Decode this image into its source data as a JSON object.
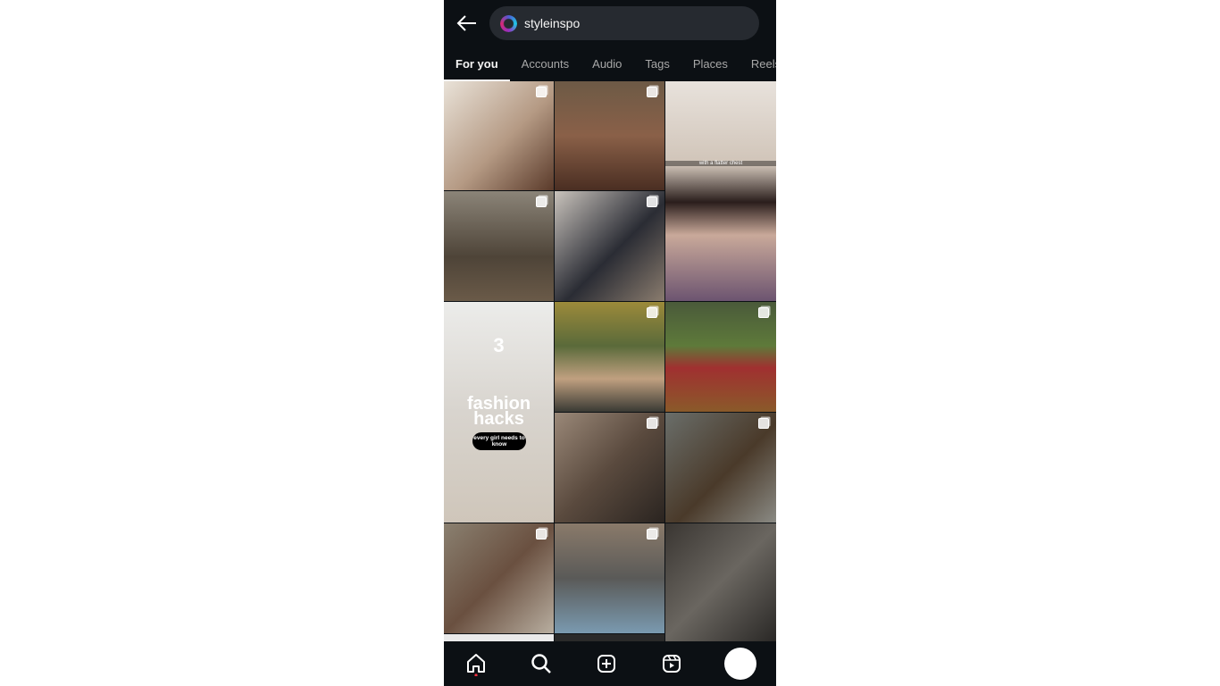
{
  "search": {
    "query": "styleinspo"
  },
  "tabs": [
    {
      "label": "For you",
      "active": true
    },
    {
      "label": "Accounts"
    },
    {
      "label": "Audio"
    },
    {
      "label": "Tags"
    },
    {
      "label": "Places"
    },
    {
      "label": "Reels"
    }
  ],
  "overlays": {
    "tile3_caption": "with a flatter chest",
    "tile6_number": "3",
    "tile6_title": "fashion hacks",
    "tile6_sub": "every girl needs to know"
  },
  "nav": [
    "home-icon",
    "search-icon",
    "create-icon",
    "reels-icon",
    "profile-avatar"
  ],
  "colors": {
    "background": "#0c1014",
    "search_bg": "#262a30",
    "notification_dot": "#ff3040"
  }
}
